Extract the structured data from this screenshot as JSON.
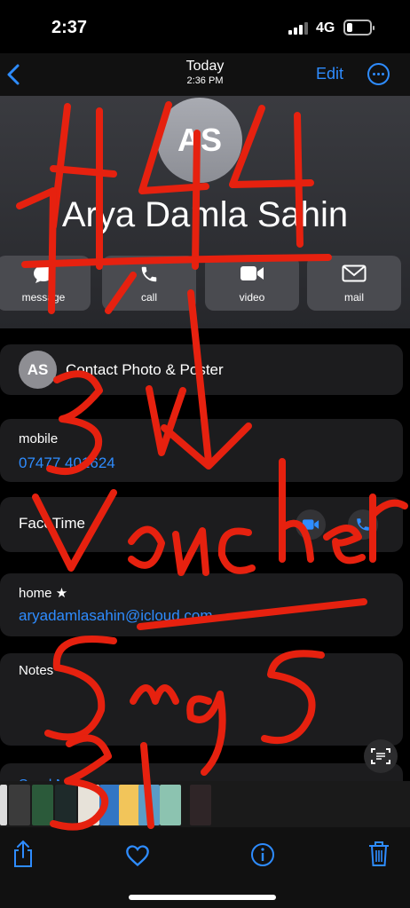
{
  "status": {
    "time": "2:37",
    "network": "4G"
  },
  "nav": {
    "back_icon": "chevron-left-icon",
    "title": "Today",
    "subtitle": "2:36 PM",
    "edit_label": "Edit",
    "more_icon": "ellipsis-circle-icon"
  },
  "contact": {
    "initials": "AS",
    "name": "Arya Damla Sahin"
  },
  "actions": [
    {
      "label": "message",
      "icon": "message-bubble-icon"
    },
    {
      "label": "call",
      "icon": "phone-icon"
    },
    {
      "label": "video",
      "icon": "video-camera-icon"
    },
    {
      "label": "mail",
      "icon": "envelope-icon"
    }
  ],
  "photo_poster": {
    "initials": "AS",
    "label": "Contact Photo & Poster"
  },
  "mobile": {
    "label": "mobile",
    "value": "07477 401624"
  },
  "facetime": {
    "label": "FaceTime"
  },
  "email": {
    "label": "home ★",
    "value": "aryadamlasahin@icloud.com"
  },
  "notes": {
    "label": "Notes"
  },
  "send_message": {
    "label": "Send Message"
  },
  "colors": {
    "accent": "#2e8cff",
    "card": "#1c1c1e",
    "scribble": "#e6210f"
  },
  "annotations": {
    "scribble_text": [
      "4 4 4",
      "1",
      "3",
      "Voucher",
      "5mg5",
      "3"
    ]
  },
  "toolbar": [
    "share-icon",
    "heart-icon",
    "info-icon",
    "trash-icon"
  ]
}
